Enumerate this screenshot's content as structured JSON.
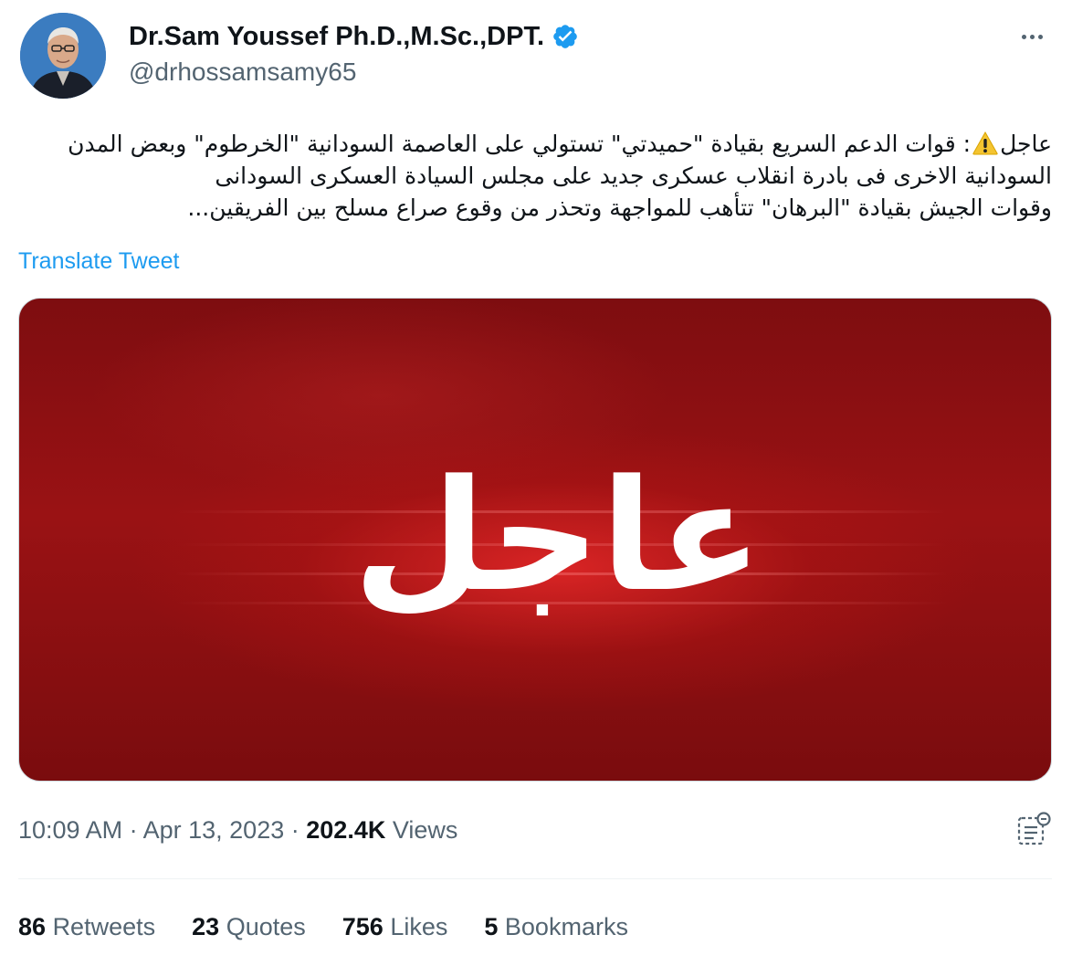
{
  "author": {
    "display_name": "Dr.Sam Youssef Ph.D.,M.Sc.,DPT.",
    "handle": "@drhossamsamy65",
    "verified_icon": "verified-badge-icon",
    "verified_color": "#1d9bf0"
  },
  "tweet": {
    "text_line_1_start": "عاجل",
    "text_line_1_end": ": قوات الدعم السريع بقيادة \"حميدتي\" تستولي على العاصمة السودانية \"الخرطوم\" وبعض المدن",
    "text_line_2": "السودانية الاخرى فى بادرة انقلاب عسكرى جديد على مجلس السيادة العسكرى السودانى",
    "text_line_3": "وقوات الجيش بقيادة \"البرهان\" تتأهب للمواجهة وتحذر من وقوع صراع مسلح بين الفريقين...",
    "translate_label": "Translate Tweet"
  },
  "media": {
    "headline": "عاجل",
    "background_color": "#8b0f12"
  },
  "meta": {
    "time": "10:09 AM",
    "separator": "·",
    "date": "Apr 13, 2023",
    "views_count": "202.4K",
    "views_label": "Views"
  },
  "stats": [
    {
      "count": "86",
      "label": "Retweets"
    },
    {
      "count": "23",
      "label": "Quotes"
    },
    {
      "count": "756",
      "label": "Likes"
    },
    {
      "count": "5",
      "label": "Bookmarks"
    }
  ],
  "colors": {
    "link": "#1d9bf0",
    "secondary_text": "#536471",
    "primary_text": "#0f1419"
  }
}
